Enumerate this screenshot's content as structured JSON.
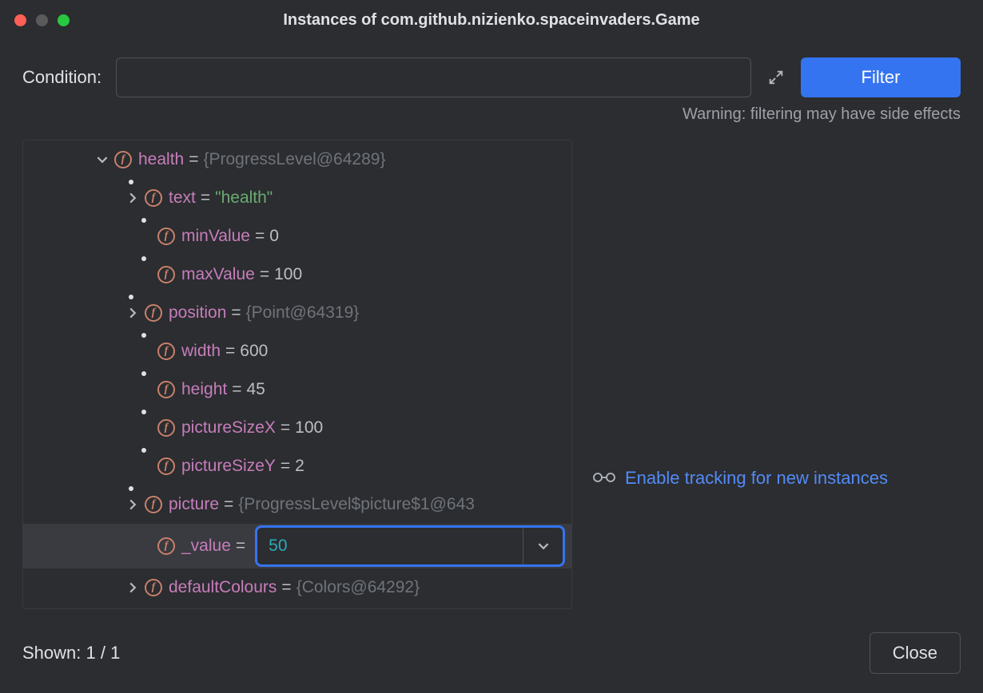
{
  "window": {
    "title": "Instances of com.github.nizienko.spaceinvaders.Game"
  },
  "condition": {
    "label": "Condition:",
    "value": "",
    "filter_label": "Filter"
  },
  "warning": "Warning: filtering may have side effects",
  "tree": {
    "root": {
      "name": "health",
      "value": "{ProgressLevel@64289}"
    },
    "children": [
      {
        "name": "text",
        "value": "\"health\"",
        "type": "string",
        "expandable": true
      },
      {
        "name": "minValue",
        "value": "0",
        "type": "number"
      },
      {
        "name": "maxValue",
        "value": "100",
        "type": "number"
      },
      {
        "name": "position",
        "value": "{Point@64319}",
        "type": "object",
        "expandable": true
      },
      {
        "name": "width",
        "value": "600",
        "type": "number"
      },
      {
        "name": "height",
        "value": "45",
        "type": "number"
      },
      {
        "name": "pictureSizeX",
        "value": "100",
        "type": "number"
      },
      {
        "name": "pictureSizeY",
        "value": "2",
        "type": "number"
      },
      {
        "name": "picture",
        "value": "{ProgressLevel$picture$1@643",
        "type": "object",
        "expandable": true
      },
      {
        "name": "_value",
        "value": "50",
        "type": "edit"
      },
      {
        "name": "defaultColours",
        "value": "{Colors@64292}",
        "type": "object",
        "expandable": true
      }
    ]
  },
  "side": {
    "link": "Enable tracking for new instances"
  },
  "footer": {
    "shown": "Shown: 1 / 1",
    "close": "Close"
  }
}
